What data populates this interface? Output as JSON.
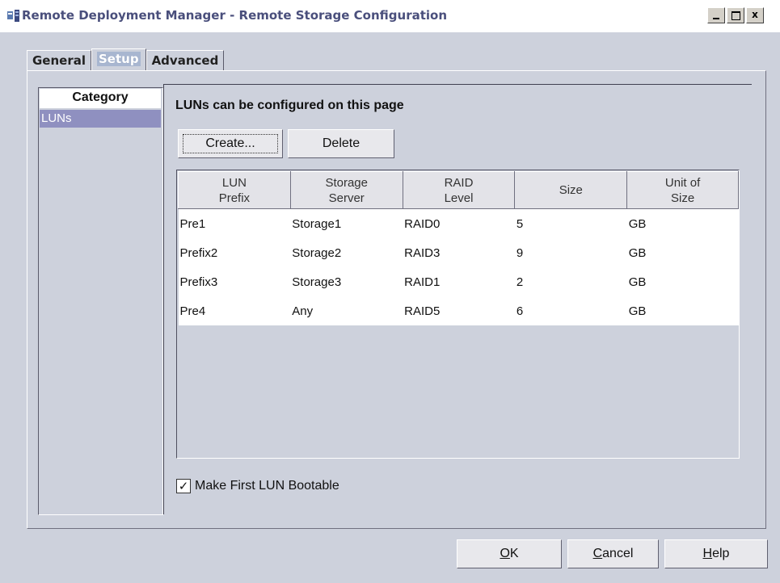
{
  "window": {
    "title": "Remote Deployment Manager - Remote Storage Configuration",
    "controls": {
      "minimize": "_",
      "maximize": "□",
      "close": "x"
    }
  },
  "tabs": [
    {
      "label": "General"
    },
    {
      "label": "Setup",
      "active": true
    },
    {
      "label": "Advanced"
    }
  ],
  "category": {
    "header": "Category",
    "items": [
      {
        "label": "LUNs",
        "selected": true
      }
    ]
  },
  "main": {
    "heading": "LUNs can be configured on this page",
    "create_label": "Create...",
    "delete_label": "Delete",
    "table": {
      "columns": [
        {
          "line1": "LUN",
          "line2": "Prefix"
        },
        {
          "line1": "Storage",
          "line2": "Server"
        },
        {
          "line1": "RAID",
          "line2": "Level"
        },
        {
          "line1": "Size",
          "line2": ""
        },
        {
          "line1": "Unit of",
          "line2": "Size"
        }
      ],
      "rows": [
        [
          "Pre1",
          "Storage1",
          "RAID0",
          "5",
          "GB"
        ],
        [
          "Prefix2",
          "Storage2",
          "RAID3",
          "9",
          "GB"
        ],
        [
          "Prefix3",
          "Storage3",
          "RAID1",
          "2",
          "GB"
        ],
        [
          "Pre4",
          "Any",
          "RAID5",
          "6",
          "GB"
        ]
      ]
    },
    "bootable_checkbox": {
      "label": "Make First LUN Bootable",
      "checked": true,
      "mark": "✓"
    }
  },
  "footer": {
    "ok": {
      "mnemonic": "O",
      "rest": "K"
    },
    "cancel": {
      "mnemonic": "C",
      "rest": "ancel"
    },
    "help": {
      "mnemonic": "H",
      "rest": "elp"
    }
  },
  "colors": {
    "window_bg": "#cdd1dc",
    "selection": "#8f90c0",
    "title_text": "#4a4f7c"
  }
}
